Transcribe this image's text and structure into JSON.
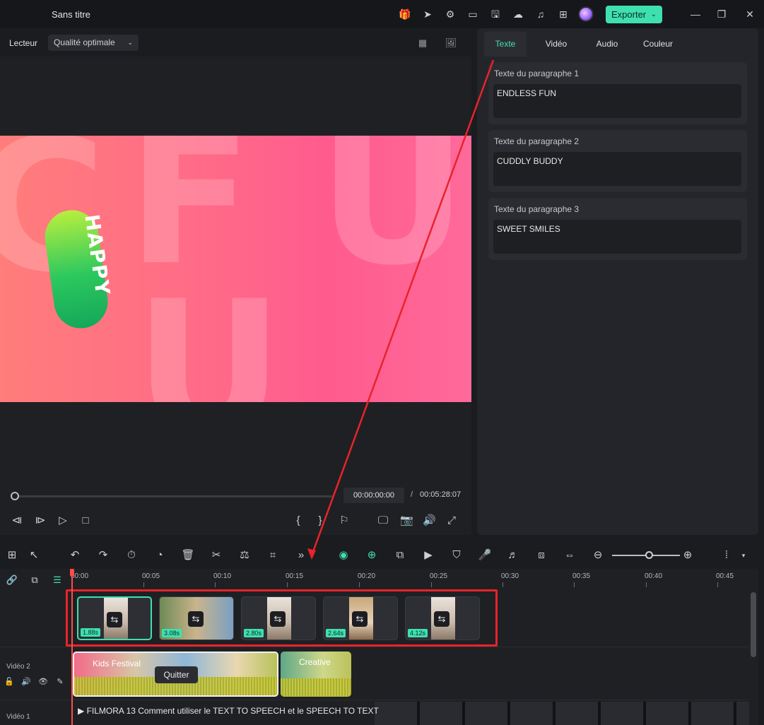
{
  "app": {
    "title": "Sans titre",
    "export_label": "Exporter"
  },
  "player": {
    "label": "Lecteur",
    "quality": "Qualité optimale",
    "current_time": "00:00:00:00",
    "separator": "/",
    "total_time": "00:05:28:07",
    "canvas_text": "HAPPY"
  },
  "right_panel": {
    "tabs": [
      {
        "label": "Texte",
        "active": true
      },
      {
        "label": "Vidéo",
        "active": false
      },
      {
        "label": "Audio",
        "active": false
      },
      {
        "label": "Couleur",
        "active": false
      }
    ],
    "paragraphs": [
      {
        "label": "Texte du paragraphe 1",
        "value": "ENDLESS FUN"
      },
      {
        "label": "Texte du paragraphe 2",
        "value": "CUDDLY BUDDY"
      },
      {
        "label": "Texte du paragraphe 3",
        "value": "SWEET SMILES"
      }
    ]
  },
  "timeline": {
    "ruler": [
      "00:00",
      "00:05",
      "00:10",
      "00:15",
      "00:20",
      "00:25",
      "00:30",
      "00:35",
      "00:40",
      "00:45"
    ],
    "clips": [
      {
        "duration": "1.88s",
        "selected": true
      },
      {
        "duration": "3.08s",
        "selected": false
      },
      {
        "duration": "2.80s",
        "selected": false
      },
      {
        "duration": "2.64s",
        "selected": false
      },
      {
        "duration": "4.12s",
        "selected": false
      }
    ],
    "templates": [
      {
        "label": "Kids Festival"
      },
      {
        "label": "Creative"
      }
    ],
    "tooltip": "Quitter",
    "tracks": {
      "video2": "Vidéo 2",
      "video1": "Vidéo 1"
    },
    "video1_clip": "FILMORA 13  Comment utiliser le TEXT TO SPEECH et le SPEECH TO TEXT"
  },
  "colors": {
    "accent": "#3fe0b0",
    "highlight_box": "#e8232a",
    "playhead": "#ff4b4b"
  }
}
